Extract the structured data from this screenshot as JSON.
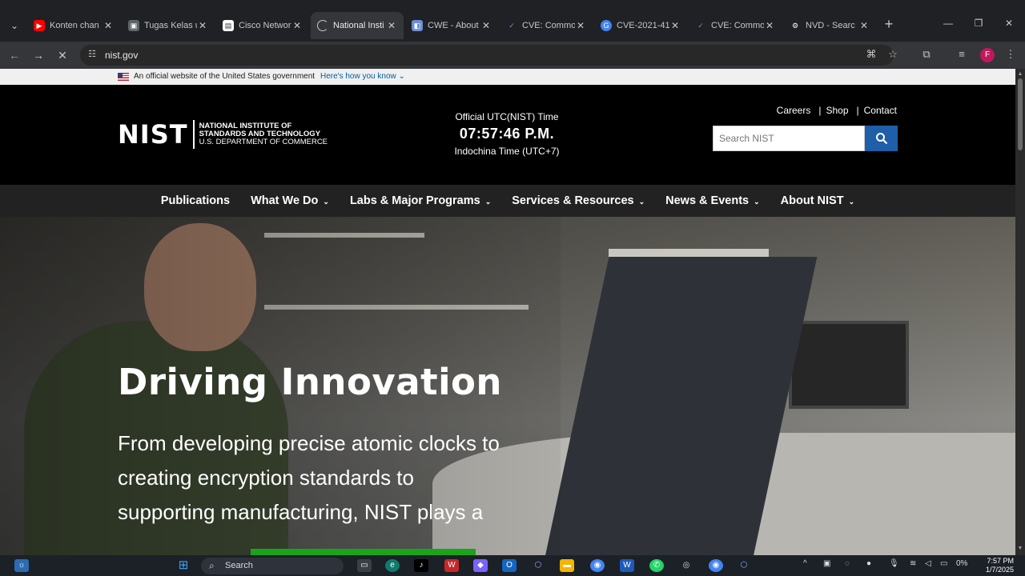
{
  "browser": {
    "tabs": [
      {
        "title": "Konten chan",
        "favicon_color": "#ff0000",
        "active": false
      },
      {
        "title": "Tugas Kelas u",
        "favicon_color": "#5f6368",
        "active": false
      },
      {
        "title": "Cisco Networ",
        "favicon_color": "#ffffff",
        "active": false
      },
      {
        "title": "National Insti",
        "favicon_color": "#c4c7c5",
        "active": true
      },
      {
        "title": "CWE - About",
        "favicon_color": "#6b8fd6",
        "active": false
      },
      {
        "title": "CVE: Commo",
        "favicon_color": "#3d5a9e",
        "active": false
      },
      {
        "title": "CVE-2021-41",
        "favicon_color": "#4285f4",
        "active": false
      },
      {
        "title": "CVE: Commo",
        "favicon_color": "#3d5a9e",
        "active": false
      },
      {
        "title": "NVD - Searc",
        "favicon_color": "#ffffff",
        "active": false
      }
    ],
    "url": "nist.gov",
    "profile_initial": "F"
  },
  "gov_banner": {
    "text": "An official website of the United States government",
    "link": "Here's how you know"
  },
  "header": {
    "logo_mark": "NIST",
    "logo_line1": "NATIONAL INSTITUTE OF",
    "logo_line2": "STANDARDS AND TECHNOLOGY",
    "logo_line3": "U.S. DEPARTMENT OF COMMERCE",
    "clock_label": "Official UTC(NIST) Time",
    "clock_time": "07:57:46 P.M.",
    "clock_zone": "Indochina Time (UTC+7)",
    "links": [
      "Careers",
      "Shop",
      "Contact"
    ],
    "search_placeholder": "Search NIST"
  },
  "nav": [
    {
      "label": "Publications",
      "dropdown": false
    },
    {
      "label": "What We Do",
      "dropdown": true
    },
    {
      "label": "Labs & Major Programs",
      "dropdown": true
    },
    {
      "label": "Services & Resources",
      "dropdown": true
    },
    {
      "label": "News & Events",
      "dropdown": true
    },
    {
      "label": "About NIST",
      "dropdown": true
    }
  ],
  "hero": {
    "title": "Driving Innovation",
    "body": "From developing precise atomic clocks to creating encryption standards to supporting manufacturing, NIST plays a"
  },
  "taskbar": {
    "search_label": "Search",
    "battery": "0%",
    "time": "7:57 PM",
    "date": "1/7/2025"
  }
}
